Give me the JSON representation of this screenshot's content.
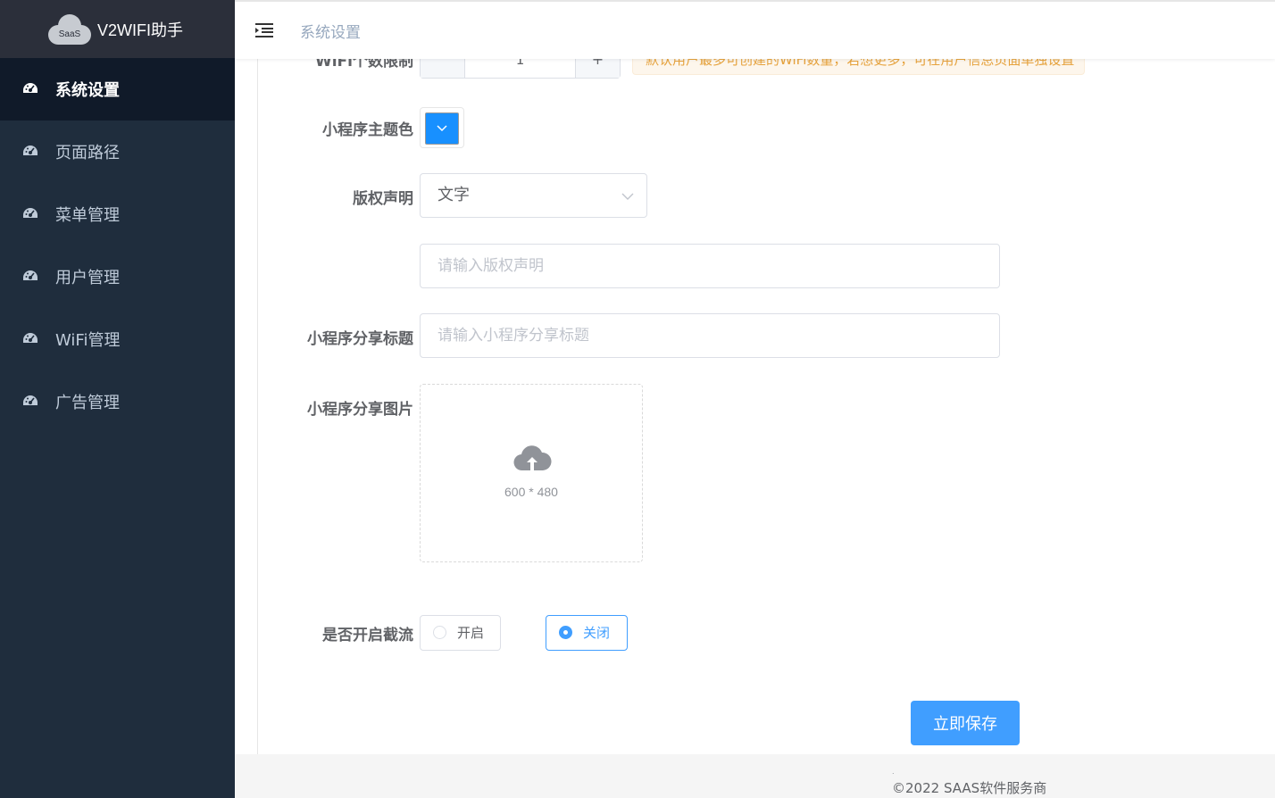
{
  "app": {
    "logo_text": "SaaS",
    "title": "V2WIFI助手"
  },
  "sidebar": {
    "items": [
      {
        "label": "系统设置",
        "icon": "dashboard-icon",
        "active": true
      },
      {
        "label": "页面路径",
        "icon": "dashboard-icon",
        "active": false
      },
      {
        "label": "菜单管理",
        "icon": "dashboard-icon",
        "active": false
      },
      {
        "label": "用户管理",
        "icon": "dashboard-icon",
        "active": false
      },
      {
        "label": "WiFi管理",
        "icon": "dashboard-icon",
        "active": false
      },
      {
        "label": "广告管理",
        "icon": "dashboard-icon",
        "active": false
      }
    ]
  },
  "header": {
    "menu_toggle_icon": "hamburger-icon",
    "breadcrumb": "系统设置"
  },
  "form": {
    "wifi_limit": {
      "label": "WiFi个数限制",
      "value": "1",
      "increment": "+",
      "tip": "默认用户最多可创建的WiFi数量，若想更多，可在用户信息页面单独设置"
    },
    "theme_color": {
      "label": "小程序主题色",
      "value": "#1890ff"
    },
    "copyright": {
      "label": "版权声明",
      "type_value": "文字",
      "placeholder": "请输入版权声明"
    },
    "share_title": {
      "label": "小程序分享标题",
      "placeholder": "请输入小程序分享标题"
    },
    "share_image": {
      "label": "小程序分享图片",
      "size_hint": "600 * 480"
    },
    "throttle": {
      "label": "是否开启截流",
      "options": [
        {
          "label": "开启",
          "checked": false
        },
        {
          "label": "关闭",
          "checked": true
        }
      ]
    },
    "save_label": "立即保存"
  },
  "footer": {
    "dot": ".",
    "copyright": "©2022 SAAS软件服务商"
  },
  "colors": {
    "sidebar_bg": "#1f2d3d",
    "sidebar_active_bg": "#101a29",
    "primary": "#409eff",
    "theme_swatch": "#1890ff"
  }
}
